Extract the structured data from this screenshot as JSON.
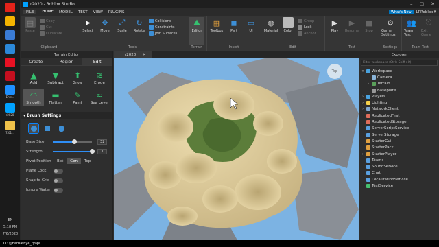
{
  "taskbar": {
    "apps": [
      {
        "label": "",
        "icon": "opera-icon",
        "color": "#e2231a"
      },
      {
        "label": "",
        "icon": "chrome-icon",
        "color": "#f4b400"
      },
      {
        "label": "",
        "icon": "screen-icon",
        "color": "#3a7bd5"
      },
      {
        "label": "",
        "icon": "mail-icon",
        "color": "#2b88d8"
      },
      {
        "label": "",
        "icon": "store-icon",
        "color": "#e81123"
      },
      {
        "label": "",
        "icon": "red-app-icon",
        "color": "#c50f1f"
      },
      {
        "label": "Enw...",
        "icon": "roblox-icon",
        "color": "#1e90ff"
      },
      {
        "label": "r2020",
        "icon": "studio-icon",
        "color": "#00a2ff"
      },
      {
        "label": "7/01...",
        "icon": "folder-icon",
        "color": "#f0c24a"
      }
    ],
    "lang": "EN",
    "time": "5:18 PM",
    "date": "7/6/2020"
  },
  "caption": "TT: @barbatnye_tyapi",
  "window": {
    "title": "r2020 - Roblox Studio",
    "menu": [
      "FILE",
      "HOME",
      "MODEL",
      "TEST",
      "VIEW",
      "PLUGINS"
    ],
    "active_menu": "HOME",
    "whats_new": "What's New",
    "user": "LPRoblox#"
  },
  "ribbon": {
    "clipboard": {
      "title": "Clipboard",
      "buttons": [
        "Paste"
      ],
      "small": [
        "Copy",
        "Cut",
        "Duplicate"
      ]
    },
    "tools": {
      "title": "Tools",
      "buttons": [
        "Select",
        "Move",
        "Scale",
        "Rotate"
      ],
      "small": [
        "Collisions",
        "Constraints",
        "Join Surfaces"
      ]
    },
    "terrain": {
      "title": "Terrain",
      "buttons": [
        "Editor"
      ]
    },
    "insert": {
      "title": "Insert",
      "buttons": [
        "Toolbox",
        "Part",
        "UI"
      ]
    },
    "edit": {
      "title": "Edit",
      "buttons": [
        "Material",
        "Color"
      ],
      "small": [
        "Group",
        "Lock",
        "Anchor"
      ]
    },
    "test": {
      "title": "Test",
      "buttons": [
        "Play",
        "Resume",
        "Stop"
      ]
    },
    "settings": {
      "title": "Settings",
      "buttons": [
        "Game Settings"
      ]
    },
    "team_test": {
      "title": "Team Test",
      "buttons": [
        "Team Test",
        "Exit Game"
      ]
    }
  },
  "terrain_editor": {
    "title": "Terrain Editor",
    "tabs": [
      "Create",
      "Region",
      "Edit"
    ],
    "active_tab": "Edit",
    "tools": [
      "Add",
      "Subtract",
      "Grow",
      "Erode",
      "Smooth",
      "Flatten",
      "Paint",
      "Sea Level"
    ],
    "active_tool": "Smooth",
    "brush_section": "Brush Settings",
    "base_size_label": "Base Size",
    "base_size_value": "32",
    "base_size_fraction": 0.55,
    "strength_label": "Strength",
    "strength_value": "1",
    "strength_fraction": 1.0,
    "pivot_label": "Pivot Position",
    "pivot_options": [
      "Bot",
      "Cen",
      "Top"
    ],
    "pivot_selected": "Cen",
    "plane_lock": "Plane Lock",
    "snap_to_grid": "Snap to Grid",
    "ignore_water": "Ignore Water"
  },
  "viewport": {
    "tab": "r2020",
    "view_cube": "Top"
  },
  "explorer": {
    "title": "Explorer",
    "filter_placeholder": "Filter workspace (Ctrl+Shift+X)",
    "items": [
      {
        "label": "Workspace",
        "level": 0,
        "arrow": "▾",
        "color": "#4aa3df"
      },
      {
        "label": "Camera",
        "level": 1,
        "arrow": "",
        "color": "#8ab4d8"
      },
      {
        "label": "Terrain",
        "level": 1,
        "arrow": "›",
        "color": "#5aa05a"
      },
      {
        "label": "Baseplate",
        "level": 1,
        "arrow": "",
        "color": "#999999"
      },
      {
        "label": "Players",
        "level": 0,
        "arrow": "›",
        "color": "#4aa3df"
      },
      {
        "label": "Lighting",
        "level": 0,
        "arrow": "›",
        "color": "#f5d04a"
      },
      {
        "label": "NetworkClient",
        "level": 0,
        "arrow": "›",
        "color": "#7fa7d1"
      },
      {
        "label": "ReplicatedFirst",
        "level": 0,
        "arrow": "",
        "color": "#e06c5a"
      },
      {
        "label": "ReplicatedStorage",
        "level": 0,
        "arrow": "",
        "color": "#e06c5a"
      },
      {
        "label": "ServerScriptService",
        "level": 0,
        "arrow": "",
        "color": "#5aa0e0"
      },
      {
        "label": "ServerStorage",
        "level": 0,
        "arrow": "",
        "color": "#5aa0e0"
      },
      {
        "label": "StarterGui",
        "level": 0,
        "arrow": "",
        "color": "#e0a040"
      },
      {
        "label": "StarterPack",
        "level": 0,
        "arrow": "",
        "color": "#e0a040"
      },
      {
        "label": "StarterPlayer",
        "level": 0,
        "arrow": "›",
        "color": "#e0a040"
      },
      {
        "label": "Teams",
        "level": 0,
        "arrow": "",
        "color": "#5aa0e0"
      },
      {
        "label": "SoundService",
        "level": 0,
        "arrow": "",
        "color": "#5aa0e0"
      },
      {
        "label": "Chat",
        "level": 0,
        "arrow": "",
        "color": "#5aa0e0"
      },
      {
        "label": "LocalizationService",
        "level": 0,
        "arrow": "",
        "color": "#5aa0e0"
      },
      {
        "label": "TestService",
        "level": 0,
        "arrow": "",
        "color": "#46c06f"
      }
    ]
  }
}
